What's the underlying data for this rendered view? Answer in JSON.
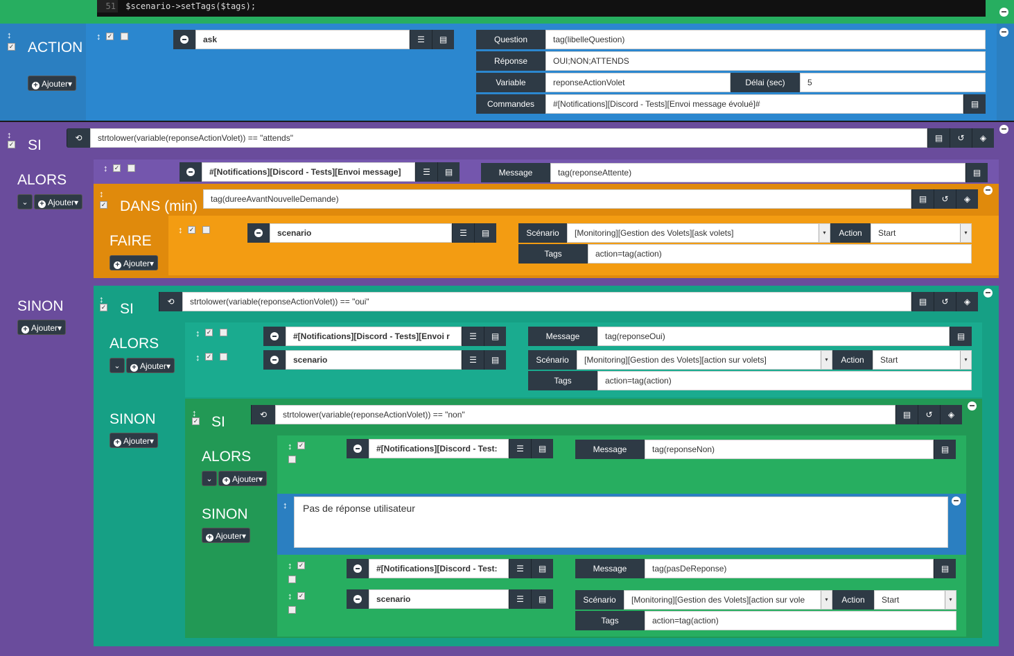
{
  "code_line": {
    "num": "51",
    "code": "$scenario->setTags($tags);"
  },
  "common": {
    "ajouter": "Ajouter",
    "alors": "ALORS",
    "sinon": "SINON",
    "si": "SI"
  },
  "action_block": {
    "title": "ACTION",
    "cmd": "ask",
    "question_label": "Question",
    "question_value": "tag(libelleQuestion)",
    "reponse_label": "Réponse",
    "reponse_value": "OUI;NON;ATTENDS",
    "variable_label": "Variable",
    "variable_value": "reponseActionVolet",
    "delai_label": "Délai (sec)",
    "delai_value": "5",
    "commandes_label": "Commandes",
    "commandes_value": "#[Notifications][Discord - Tests][Envoi message évolué]#"
  },
  "si1": {
    "condition": "strtolower(variable(reponseActionVolet)) == \"attends\"",
    "alors_cmd": "#[Notifications][Discord - Tests][Envoi message]",
    "message_label": "Message",
    "message_value": "tag(reponseAttente)",
    "dans": {
      "title": "DANS (min)",
      "value": "tag(dureeAvantNouvelleDemande)",
      "faire": "FAIRE",
      "cmd": "scenario",
      "scenario_label": "Scénario",
      "scenario_value": "[Monitoring][Gestion des Volets][ask volets]",
      "action_label": "Action",
      "action_value": "Start",
      "tags_label": "Tags",
      "tags_value": "action=tag(action)"
    }
  },
  "si2": {
    "condition": "strtolower(variable(reponseActionVolet)) == \"oui\"",
    "cmd1": "#[Notifications][Discord - Tests][Envoi r",
    "message_label": "Message",
    "message_value": "tag(reponseOui)",
    "cmd2": "scenario",
    "scenario_label": "Scénario",
    "scenario_value": "[Monitoring][Gestion des Volets][action sur volets]",
    "action_label": "Action",
    "action_value": "Start",
    "tags_label": "Tags",
    "tags_value": "action=tag(action)"
  },
  "si3": {
    "condition": "strtolower(variable(reponseActionVolet)) == \"non\"",
    "cmd1": "#[Notifications][Discord - Test:",
    "message_label": "Message",
    "message_value": "tag(reponseNon)",
    "comment": "Pas de réponse utilisateur",
    "cmd2": "#[Notifications][Discord - Test:",
    "message2_value": "tag(pasDeReponse)",
    "cmd3": "scenario",
    "scenario_label": "Scénario",
    "scenario_value": "[Monitoring][Gestion des Volets][action sur vole",
    "action_label": "Action",
    "action_value": "Start",
    "tags_label": "Tags",
    "tags_value": "action=tag(action)"
  },
  "colors": {
    "action": "#2b7fc1",
    "si": "#6a4c9c",
    "dans": "#e08a0c",
    "sinon_teal": "#16a085",
    "green": "#27ae60",
    "dark": "#2e3a45"
  }
}
